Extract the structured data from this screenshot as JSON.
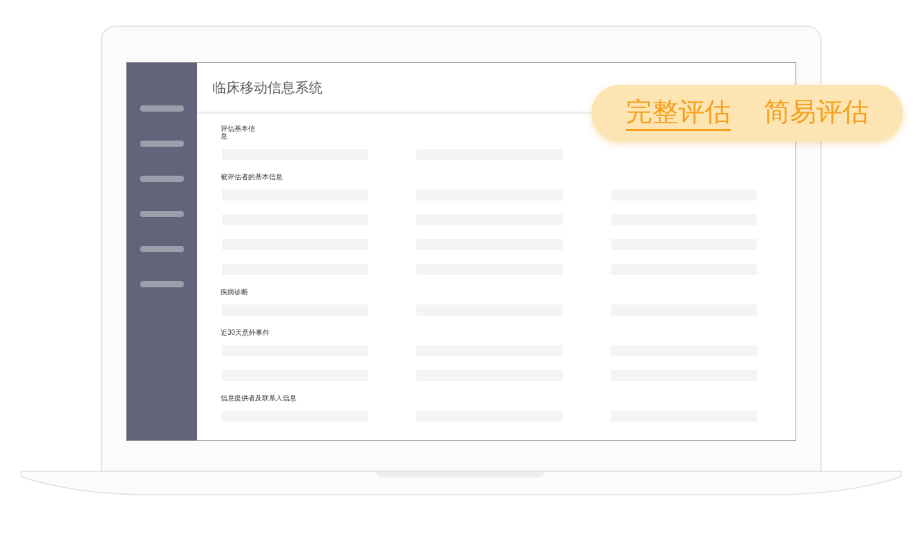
{
  "app": {
    "title": "临床移动信息系统"
  },
  "sections": [
    {
      "title": "评估基本信息"
    },
    {
      "title": "被评估者的基本信息"
    },
    {
      "title": "疾病诊断"
    },
    {
      "title": "近30天意外事件"
    },
    {
      "title": "信息提供者及联系人信息"
    }
  ],
  "mode_tabs": [
    {
      "label": "完整评估",
      "selected": true
    },
    {
      "label": "简易评估",
      "selected": false
    }
  ]
}
